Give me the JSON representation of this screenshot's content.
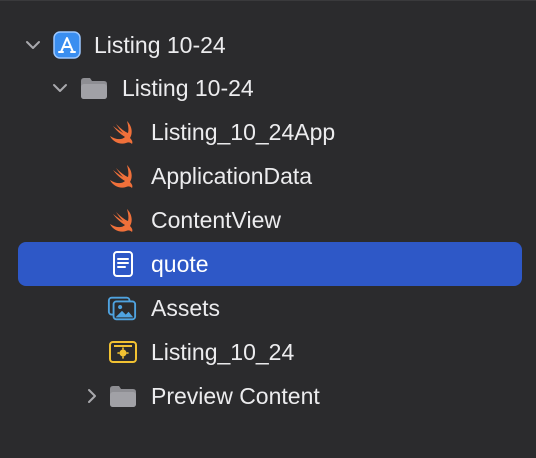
{
  "navigator": {
    "project": {
      "label": "Listing 10-24",
      "icon": "app-project-icon",
      "expanded": true
    },
    "group": {
      "label": "Listing 10-24",
      "icon": "folder-icon",
      "expanded": true
    },
    "items": [
      {
        "label": "Listing_10_24App",
        "icon": "swift-file-icon"
      },
      {
        "label": "ApplicationData",
        "icon": "swift-file-icon"
      },
      {
        "label": "ContentView",
        "icon": "swift-file-icon"
      },
      {
        "label": "quote",
        "icon": "text-file-icon",
        "selected": true
      },
      {
        "label": "Assets",
        "icon": "asset-catalog-icon"
      },
      {
        "label": "Listing_10_24",
        "icon": "entitlements-icon"
      }
    ],
    "preview_group": {
      "label": "Preview Content",
      "icon": "folder-icon",
      "expanded": false
    }
  },
  "colors": {
    "background": "#2b2b2d",
    "selection": "#2e58c7",
    "swift": "#f0703a",
    "project_icon": "#3a8ef0",
    "folder": "#8e8e93"
  }
}
